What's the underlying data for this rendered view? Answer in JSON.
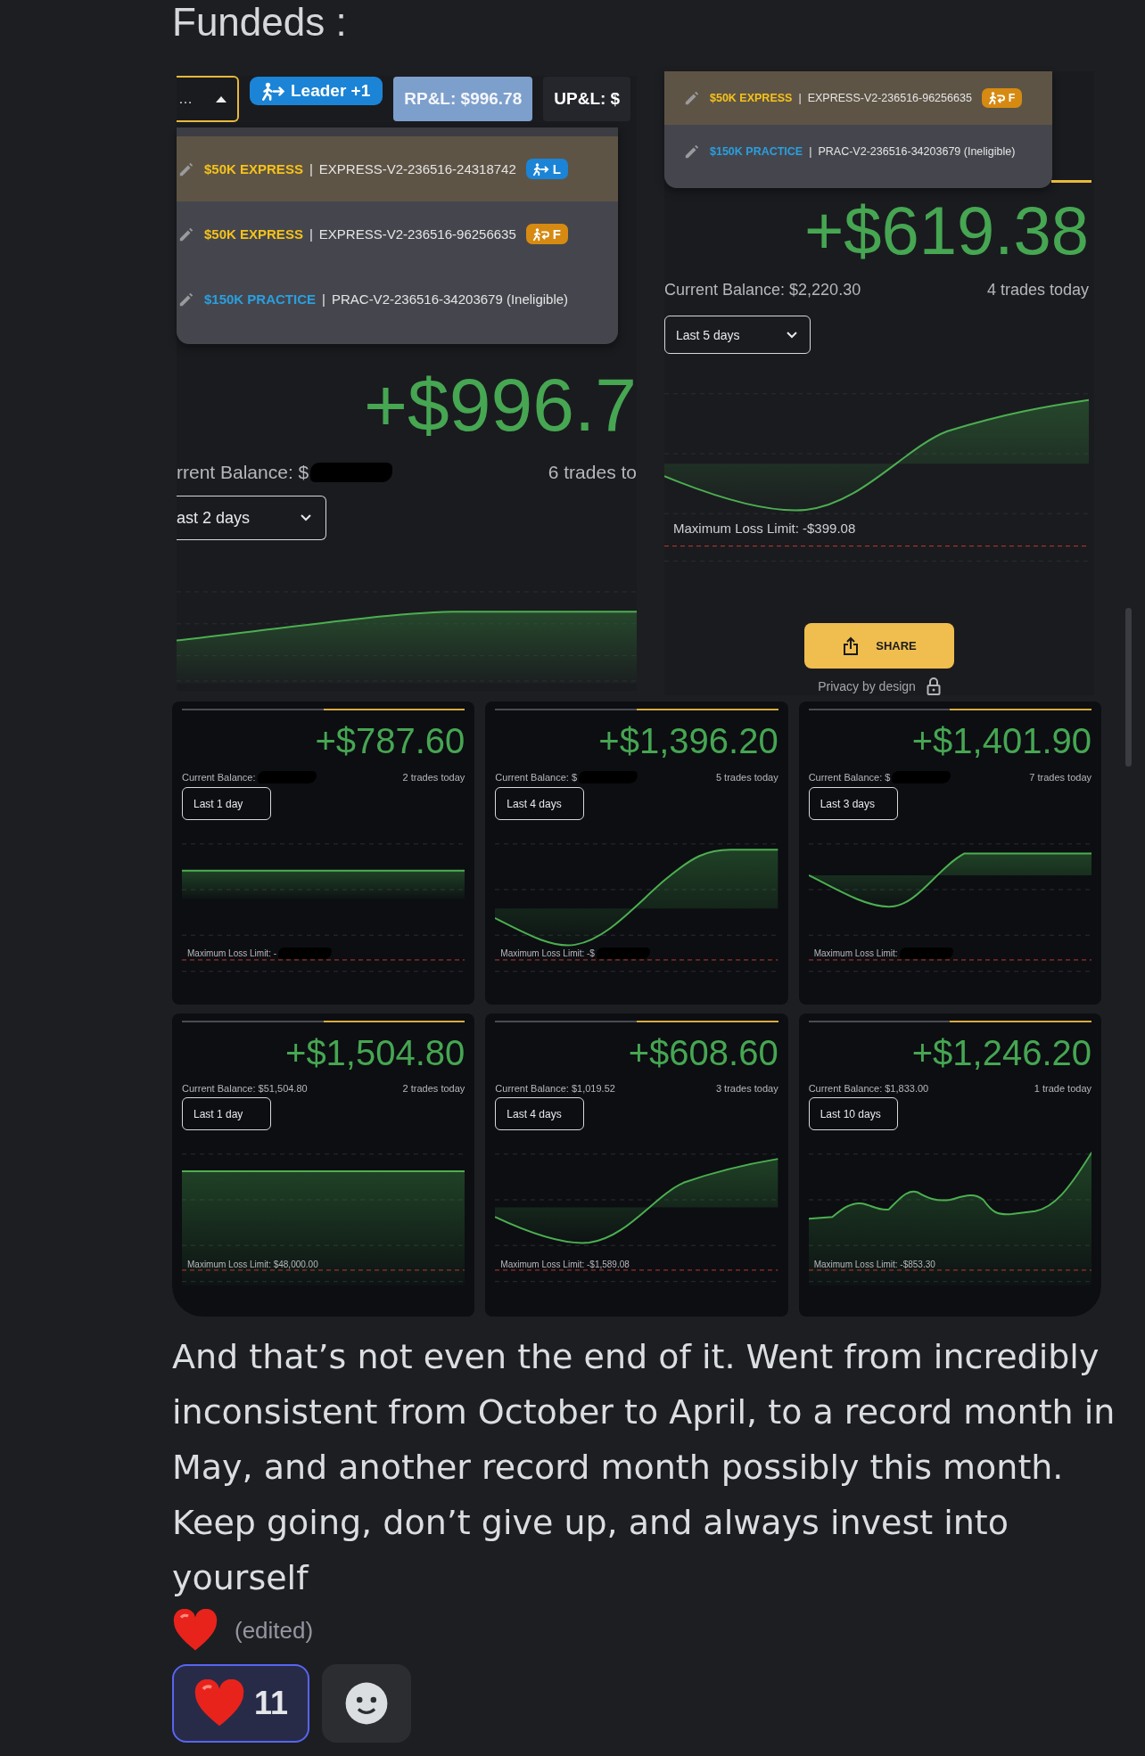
{
  "heading": "Fundeds :",
  "left_screenshot": {
    "account_select": {
      "value": "…",
      "expanded": true
    },
    "role_badge": {
      "kind": "leader",
      "label": "Leader +1"
    },
    "stats": [
      {
        "kind": "realized",
        "label": "RP&L: $996.78"
      },
      {
        "kind": "unrealized",
        "label": "UP&L: $"
      }
    ],
    "menu": [
      {
        "plan": "$50K EXPRESS",
        "color": "#f5c21b",
        "separator": "|",
        "account": "EXPRESS-V2-236516-24318742",
        "badge": {
          "kind": "leader",
          "label": "L"
        },
        "selected": true
      },
      {
        "plan": "$50K EXPRESS",
        "color": "#f5c21b",
        "separator": "|",
        "account": "EXPRESS-V2-236516-96256635",
        "badge": {
          "kind": "follower",
          "label": "F"
        },
        "selected": false
      },
      {
        "plan": "$150K PRACTICE",
        "color": "#2a9fe0",
        "separator": "|",
        "account": "PRAC-V2-236516-34203679 (Ineligible)",
        "selected": false
      }
    ],
    "pnl": "+$996.7",
    "balance": {
      "text": "rrent Balance: $",
      "redacted": true
    },
    "trades": "6 trades to",
    "period": "ast 2 days"
  },
  "right_screenshot": {
    "menu": [
      {
        "plan": "$50K EXPRESS",
        "color": "#f5c21b",
        "separator": "|",
        "account": "EXPRESS-V2-236516-96256635",
        "badge": {
          "kind": "follower",
          "label": "F"
        },
        "selected": true
      },
      {
        "plan": "$150K PRACTICE",
        "color": "#2a9fe0",
        "separator": "|",
        "account": "PRAC-V2-236516-34203679 (Ineligible)",
        "selected": false
      }
    ],
    "pnl": "+$619.38",
    "balance": {
      "text": "Current Balance: $2,220.30"
    },
    "trades": "4 trades today",
    "period": "Last 5 days",
    "loss_limit": {
      "text": "Maximum Loss Limit: -$399.08"
    },
    "share": "SHARE",
    "privacy": "Privacy by design"
  },
  "cards": [
    {
      "pnl": "+$787.60",
      "balance": {
        "text": "Current Balance:",
        "redacted": true
      },
      "trades": "2 trades today",
      "period": "Last 1 day",
      "loss_limit": {
        "text": "Maximum Loss Limit: -",
        "redacted": true
      }
    },
    {
      "pnl": "+$1,396.20",
      "balance": {
        "text": "Current Balance: $",
        "redacted": true
      },
      "trades": "5 trades today",
      "period": "Last 4 days",
      "loss_limit": {
        "text": "Maximum Loss Limit: -$",
        "redacted": true
      }
    },
    {
      "pnl": "+$1,401.90",
      "balance": {
        "text": "Current Balance: $",
        "redacted": true
      },
      "trades": "7 trades today",
      "period": "Last 3 days",
      "loss_limit": {
        "text": "Maximum Loss Limit:",
        "redacted": true
      }
    },
    {
      "pnl": "+$1,504.80",
      "balance": {
        "text": "Current Balance: $51,504.80"
      },
      "trades": "2 trades today",
      "period": "Last 1 day",
      "loss_limit": {
        "text": "Maximum Loss Limit: $48,000.00"
      }
    },
    {
      "pnl": "+$608.60",
      "balance": {
        "text": "Current Balance: $1,019.52"
      },
      "trades": "3 trades today",
      "period": "Last 4 days",
      "loss_limit": {
        "text": "Maximum Loss Limit: -$1,589.08"
      }
    },
    {
      "pnl": "+$1,246.20",
      "balance": {
        "text": "Current Balance: $1,833.00"
      },
      "trades": "1 trade today",
      "period": "Last 10 days",
      "loss_limit": {
        "text": "Maximum Loss Limit: -$853.30"
      }
    }
  ],
  "message": {
    "text": "And that’s not even the end of it. Went from incredibly inconsistent from October to April, to a record month in May, and another record month possibly this month. Keep going, don’t give up, and always invest into yourself",
    "edited": "(edited)"
  },
  "reactions": [
    {
      "kind": "heart",
      "count": "11",
      "selected": true
    },
    {
      "kind": "add",
      "selected": false
    }
  ]
}
